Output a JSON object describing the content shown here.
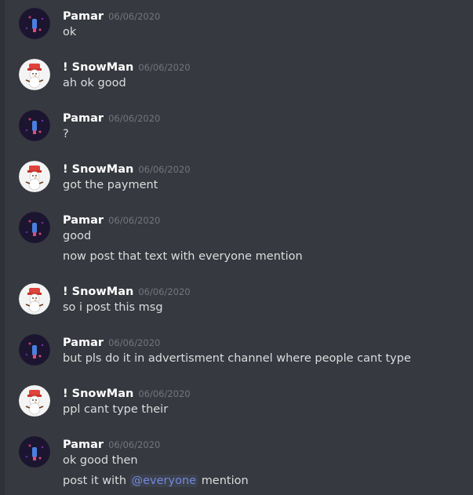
{
  "channel": {
    "messages": [
      {
        "author": "Pamar",
        "avatar": "pamar-avatar",
        "timestamp": "06/06/2020",
        "lines": [
          "ok"
        ]
      },
      {
        "author": "! SnowMan",
        "avatar": "snowman-avatar",
        "timestamp": "06/06/2020",
        "lines": [
          "ah ok good"
        ]
      },
      {
        "author": "Pamar",
        "avatar": "pamar-avatar",
        "timestamp": "06/06/2020",
        "lines": [
          "?"
        ]
      },
      {
        "author": "! SnowMan",
        "avatar": "snowman-avatar",
        "timestamp": "06/06/2020",
        "lines": [
          "got the payment"
        ]
      },
      {
        "author": "Pamar",
        "avatar": "pamar-avatar",
        "timestamp": "06/06/2020",
        "lines": [
          "good",
          "now post that text with everyone mention"
        ]
      },
      {
        "author": "! SnowMan",
        "avatar": "snowman-avatar",
        "timestamp": "06/06/2020",
        "lines": [
          "so i post this msg"
        ]
      },
      {
        "author": "Pamar",
        "avatar": "pamar-avatar",
        "timestamp": "06/06/2020",
        "lines": [
          "but pls do it in advertisment channel where people cant type"
        ]
      },
      {
        "author": "! SnowMan",
        "avatar": "snowman-avatar",
        "timestamp": "06/06/2020",
        "lines": [
          "ppl cant type their"
        ]
      },
      {
        "author": "Pamar",
        "avatar": "pamar-avatar",
        "timestamp": "06/06/2020",
        "lines": [
          "ok good then",
          "post it with"
        ]
      }
    ],
    "last_line_mention": "@everyone",
    "last_line_suffix": "mention"
  },
  "colors": {
    "background": "#36393f",
    "username": "#ffffff",
    "timestamp": "#72767d",
    "text": "#dcddde",
    "mention": "#7289da"
  }
}
